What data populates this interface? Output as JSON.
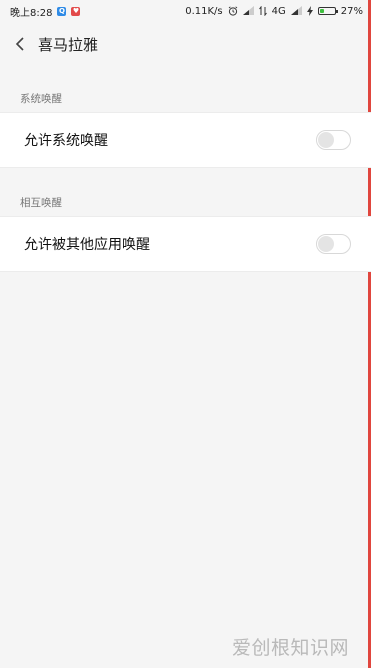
{
  "status_bar": {
    "time": "晚上8:28",
    "network_speed": "0.11K/s",
    "network_type": "4G",
    "battery": "27%",
    "battery_level": 0.27,
    "icons": [
      "blue-app-notification-icon",
      "red-app-notification-icon",
      "alarm-icon",
      "signal-icon",
      "data-arrows-icon",
      "signal-icon",
      "charging-icon",
      "battery-icon"
    ]
  },
  "header": {
    "back_icon": "chevron-left-icon",
    "title": "喜马拉雅"
  },
  "sections": [
    {
      "label": "系统唤醒",
      "item_label": "允许系统唤醒",
      "toggle_on": false
    },
    {
      "label": "相互唤醒",
      "item_label": "允许被其他应用唤醒",
      "toggle_on": false
    }
  ],
  "watermark": "爱创根知识网",
  "colors": {
    "background": "#f5f5f5",
    "row_background": "#ffffff",
    "accent_edge": "#e0463e",
    "battery_green": "#3fbf3f"
  }
}
